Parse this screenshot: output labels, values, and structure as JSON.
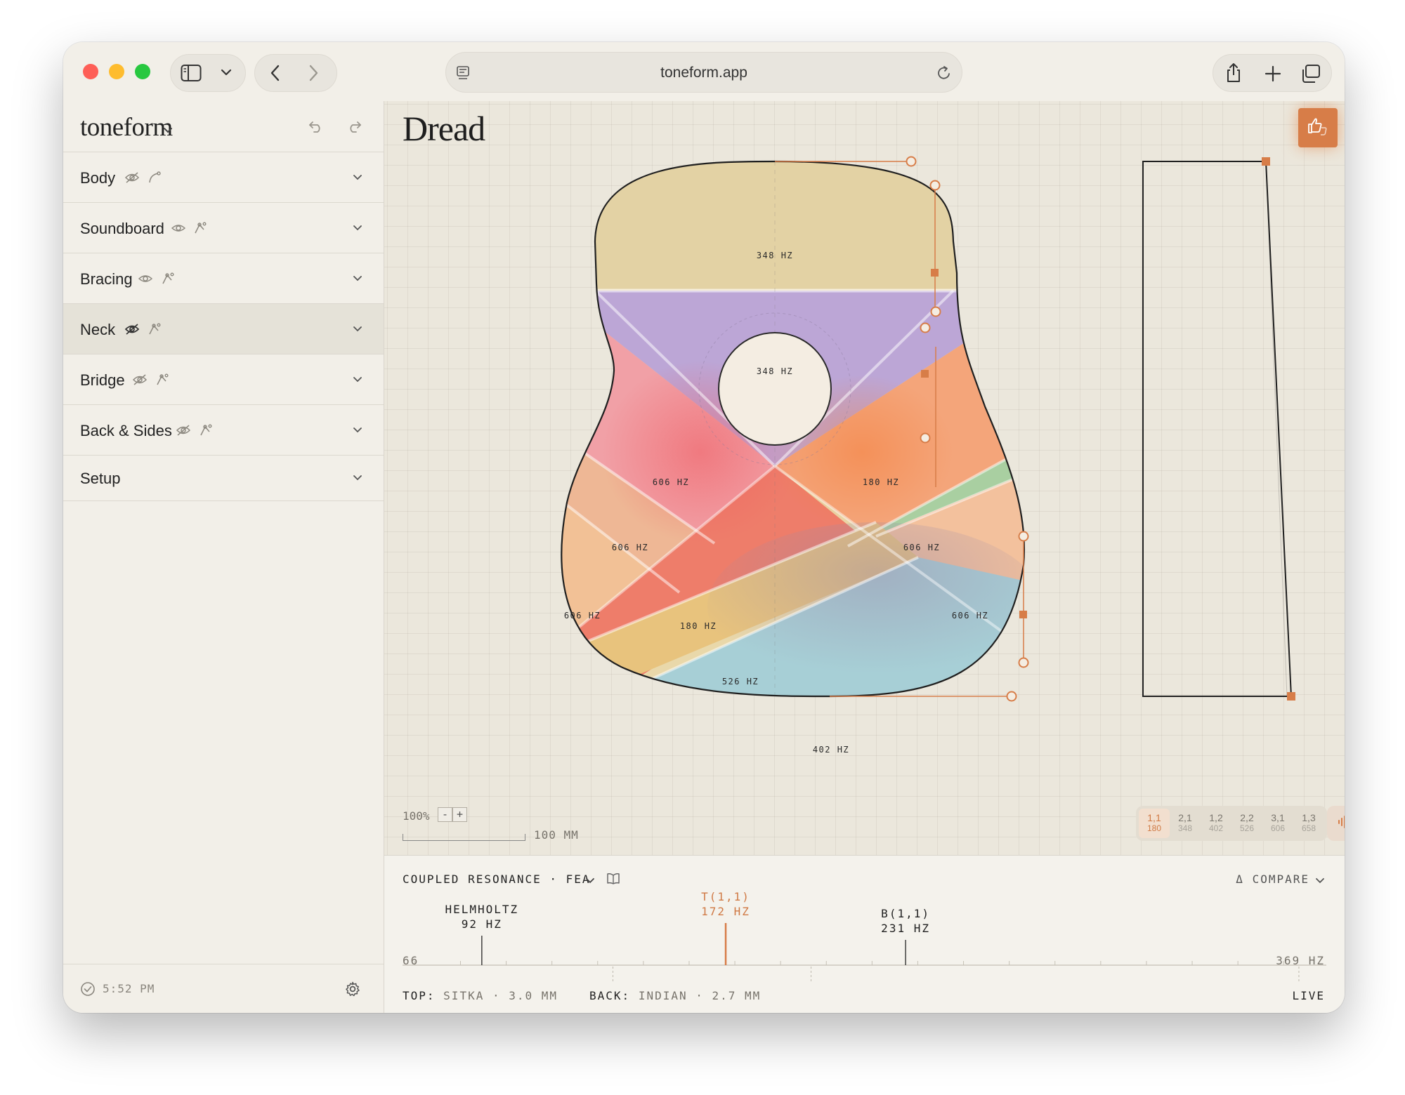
{
  "browser": {
    "url": "toneform.app",
    "traffic_colors": {
      "close": "#fe5f57",
      "minimize": "#febc2e",
      "maximize": "#28c840"
    }
  },
  "app": {
    "name": "toneform",
    "accent": "#d77d48"
  },
  "sidebar": {
    "items": [
      {
        "label": "Body",
        "visible": false
      },
      {
        "label": "Soundboard",
        "visible": true
      },
      {
        "label": "Bracing",
        "visible": true
      },
      {
        "label": "Neck",
        "visible": false,
        "active": true
      },
      {
        "label": "Bridge",
        "visible": false
      },
      {
        "label": "Back & Sides",
        "visible": false
      },
      {
        "label": "Setup"
      }
    ],
    "time": "5:52 PM"
  },
  "canvas": {
    "title": "Dread",
    "zoom": "100%",
    "zoom_out": "-",
    "zoom_in": "+",
    "scale_label": "100 MM",
    "zones": [
      {
        "label": "348 HZ",
        "color": "#e3d2a4"
      },
      {
        "label": "348 HZ",
        "color": "#bca6d6"
      },
      {
        "label": "606 HZ",
        "color": "#f1a0a6"
      },
      {
        "label": "180 HZ",
        "color": "#f4a57a"
      },
      {
        "label": "606 HZ",
        "color": "#eeb795"
      },
      {
        "label": "606 HZ",
        "color": "#a9cfa1"
      },
      {
        "label": "606 HZ",
        "color": "#f2c196"
      },
      {
        "label": "180 HZ",
        "color": "#ee7d6a"
      },
      {
        "label": "606 HZ",
        "color": "#f3c19d"
      },
      {
        "label": "526 HZ",
        "color": "#e8c37d"
      },
      {
        "label": "402 HZ",
        "color": "#a7cfd6"
      }
    ],
    "modes": [
      {
        "mode": "1,1",
        "freq": "180",
        "selected": true
      },
      {
        "mode": "2,1",
        "freq": "348"
      },
      {
        "mode": "1,2",
        "freq": "402"
      },
      {
        "mode": "2,2",
        "freq": "526"
      },
      {
        "mode": "3,1",
        "freq": "606"
      },
      {
        "mode": "1,3",
        "freq": "658"
      }
    ]
  },
  "panel": {
    "title": "COUPLED RESONANCE · FEA",
    "compare": "Δ COMPARE",
    "axis_min": "66",
    "axis_max": "369 HZ",
    "axis_range": [
      66,
      369
    ],
    "peaks": [
      {
        "name": "HELMHOLTZ",
        "value": "92 HZ",
        "freq": 92,
        "highlight": false
      },
      {
        "name": "T(1,1)",
        "value": "172 HZ",
        "freq": 172,
        "highlight": true
      },
      {
        "name": "B(1,1)",
        "value": "231 HZ",
        "freq": 231,
        "highlight": false
      }
    ],
    "top_label": "TOP:",
    "top_value": "SITKA · 3.0 MM",
    "back_label": "BACK:",
    "back_value": "INDIAN · 2.7 MM",
    "status": "LIVE"
  }
}
